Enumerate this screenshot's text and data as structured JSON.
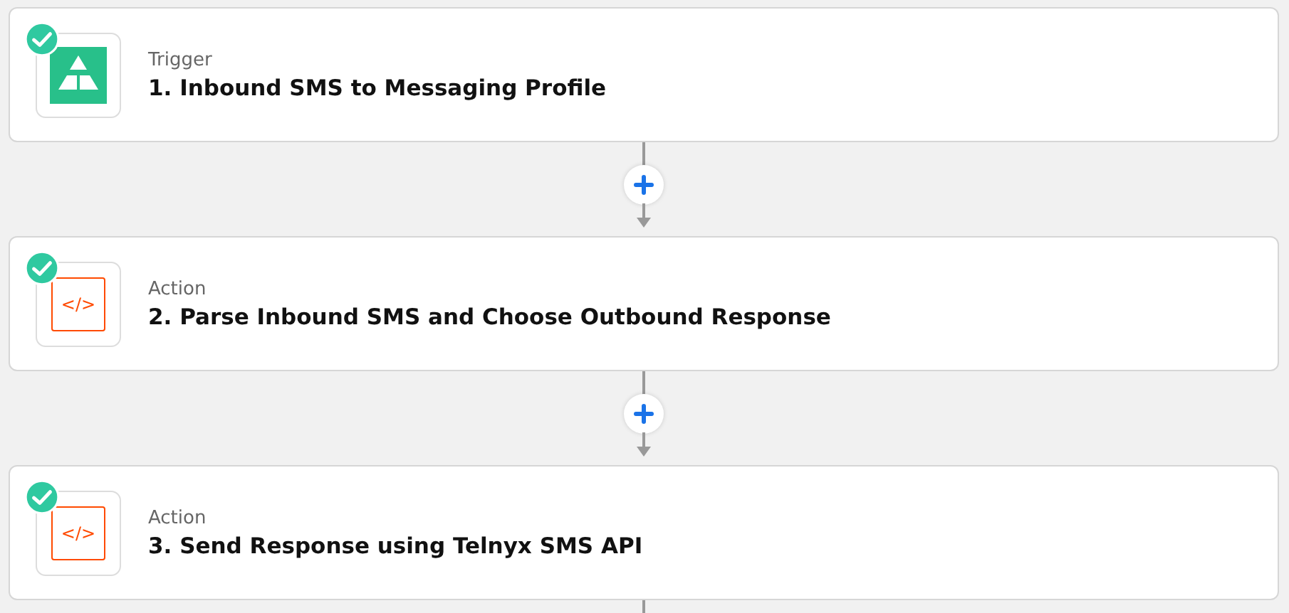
{
  "steps": [
    {
      "kind": "app",
      "done": true,
      "type_label": "Trigger",
      "title": "1. Inbound SMS to Messaging Profile"
    },
    {
      "kind": "code",
      "done": true,
      "type_label": "Action",
      "title": "2. Parse Inbound SMS and Choose Outbound Response",
      "icon_text": "</>"
    },
    {
      "kind": "code",
      "done": true,
      "type_label": "Action",
      "title": "3. Send Response using Telnyx SMS API",
      "icon_text": "</>"
    }
  ]
}
